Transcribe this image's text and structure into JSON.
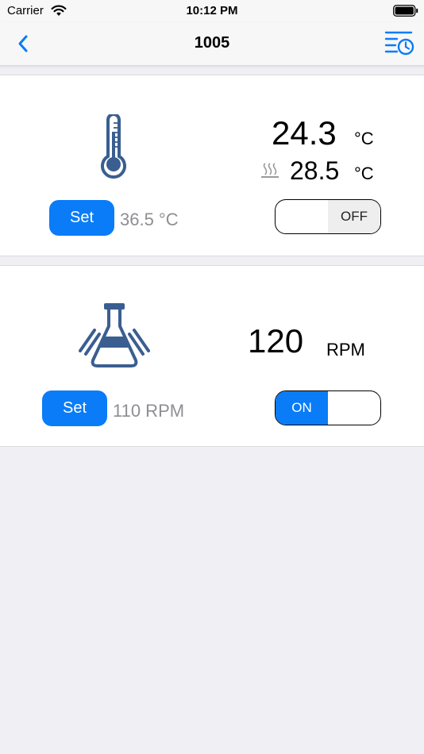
{
  "status": {
    "carrier": "Carrier",
    "time": "10:12 PM"
  },
  "nav": {
    "title": "1005"
  },
  "temperature": {
    "current_value": "24.3",
    "current_unit": "°C",
    "heater_value": "28.5",
    "heater_unit": "°C",
    "set_label": "Set",
    "set_value": "36.5 °C",
    "toggle_label": "OFF",
    "toggle_state": "off"
  },
  "shaker": {
    "current_value": "120",
    "current_unit": "RPM",
    "set_label": "Set",
    "set_value": "110 RPM",
    "toggle_label": "ON",
    "toggle_state": "on"
  },
  "colors": {
    "accent": "#0a7cf7",
    "icon": "#3a5e90",
    "background": "#efeff4"
  }
}
